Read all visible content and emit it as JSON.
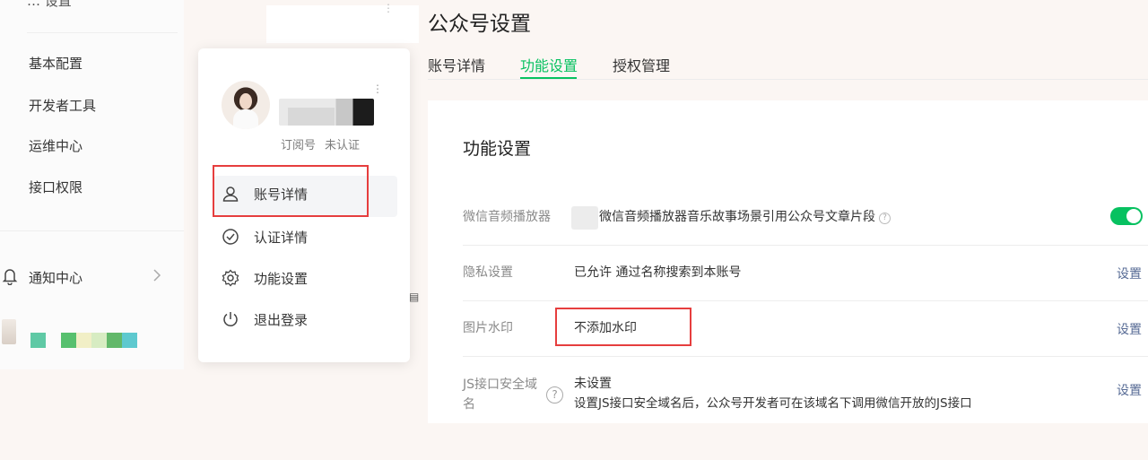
{
  "sidebar": {
    "top_cut_label": "… 设置",
    "nav_items": [
      {
        "label": "基本配置"
      },
      {
        "label": "开发者工具"
      },
      {
        "label": "运维中心"
      },
      {
        "label": "接口权限"
      }
    ],
    "notice": {
      "label": "通知中心",
      "icon": "bell-icon"
    },
    "mosaic_colors": [
      "#5fc9a5",
      "#57c06e",
      "#f1efc6",
      "#d7ecc2",
      "#62b86a",
      "#5ec9cf"
    ]
  },
  "popup": {
    "account_type": "订阅号",
    "verify_status": "未认证",
    "more_glyph": "⋮",
    "menu": [
      {
        "label": "账号详情",
        "icon": "user-icon"
      },
      {
        "label": "认证详情",
        "icon": "check-circle-icon"
      },
      {
        "label": "功能设置",
        "icon": "gear-icon"
      },
      {
        "label": "退出登录",
        "icon": "power-icon"
      }
    ]
  },
  "main": {
    "page_title": "公众号设置",
    "tabs": [
      {
        "label": "账号详情",
        "active": false
      },
      {
        "label": "功能设置",
        "active": true
      },
      {
        "label": "授权管理",
        "active": false
      }
    ],
    "section_title": "功能设置",
    "rows": [
      {
        "label": "微信音频播放器",
        "value": "微信音频播放器音乐故事场景引用公众号文章片段",
        "toggle_on": true
      },
      {
        "label": "隐私设置",
        "value": "已允许 通过名称搜索到本账号",
        "action": "设置"
      },
      {
        "label": "图片水印",
        "value": "不添加水印",
        "action": "设置"
      },
      {
        "label_line1": "JS接口安全域",
        "label_line2": "名",
        "value_line1": "未设置",
        "value_line2": "设置JS接口安全域名后，公众号开发者可在该域名下调用微信开放的JS接口",
        "action": "设置"
      }
    ],
    "help_glyph": "?"
  },
  "colors": {
    "accent": "#07c160",
    "link": "#576b95",
    "highlight_border": "#e63e3e"
  }
}
